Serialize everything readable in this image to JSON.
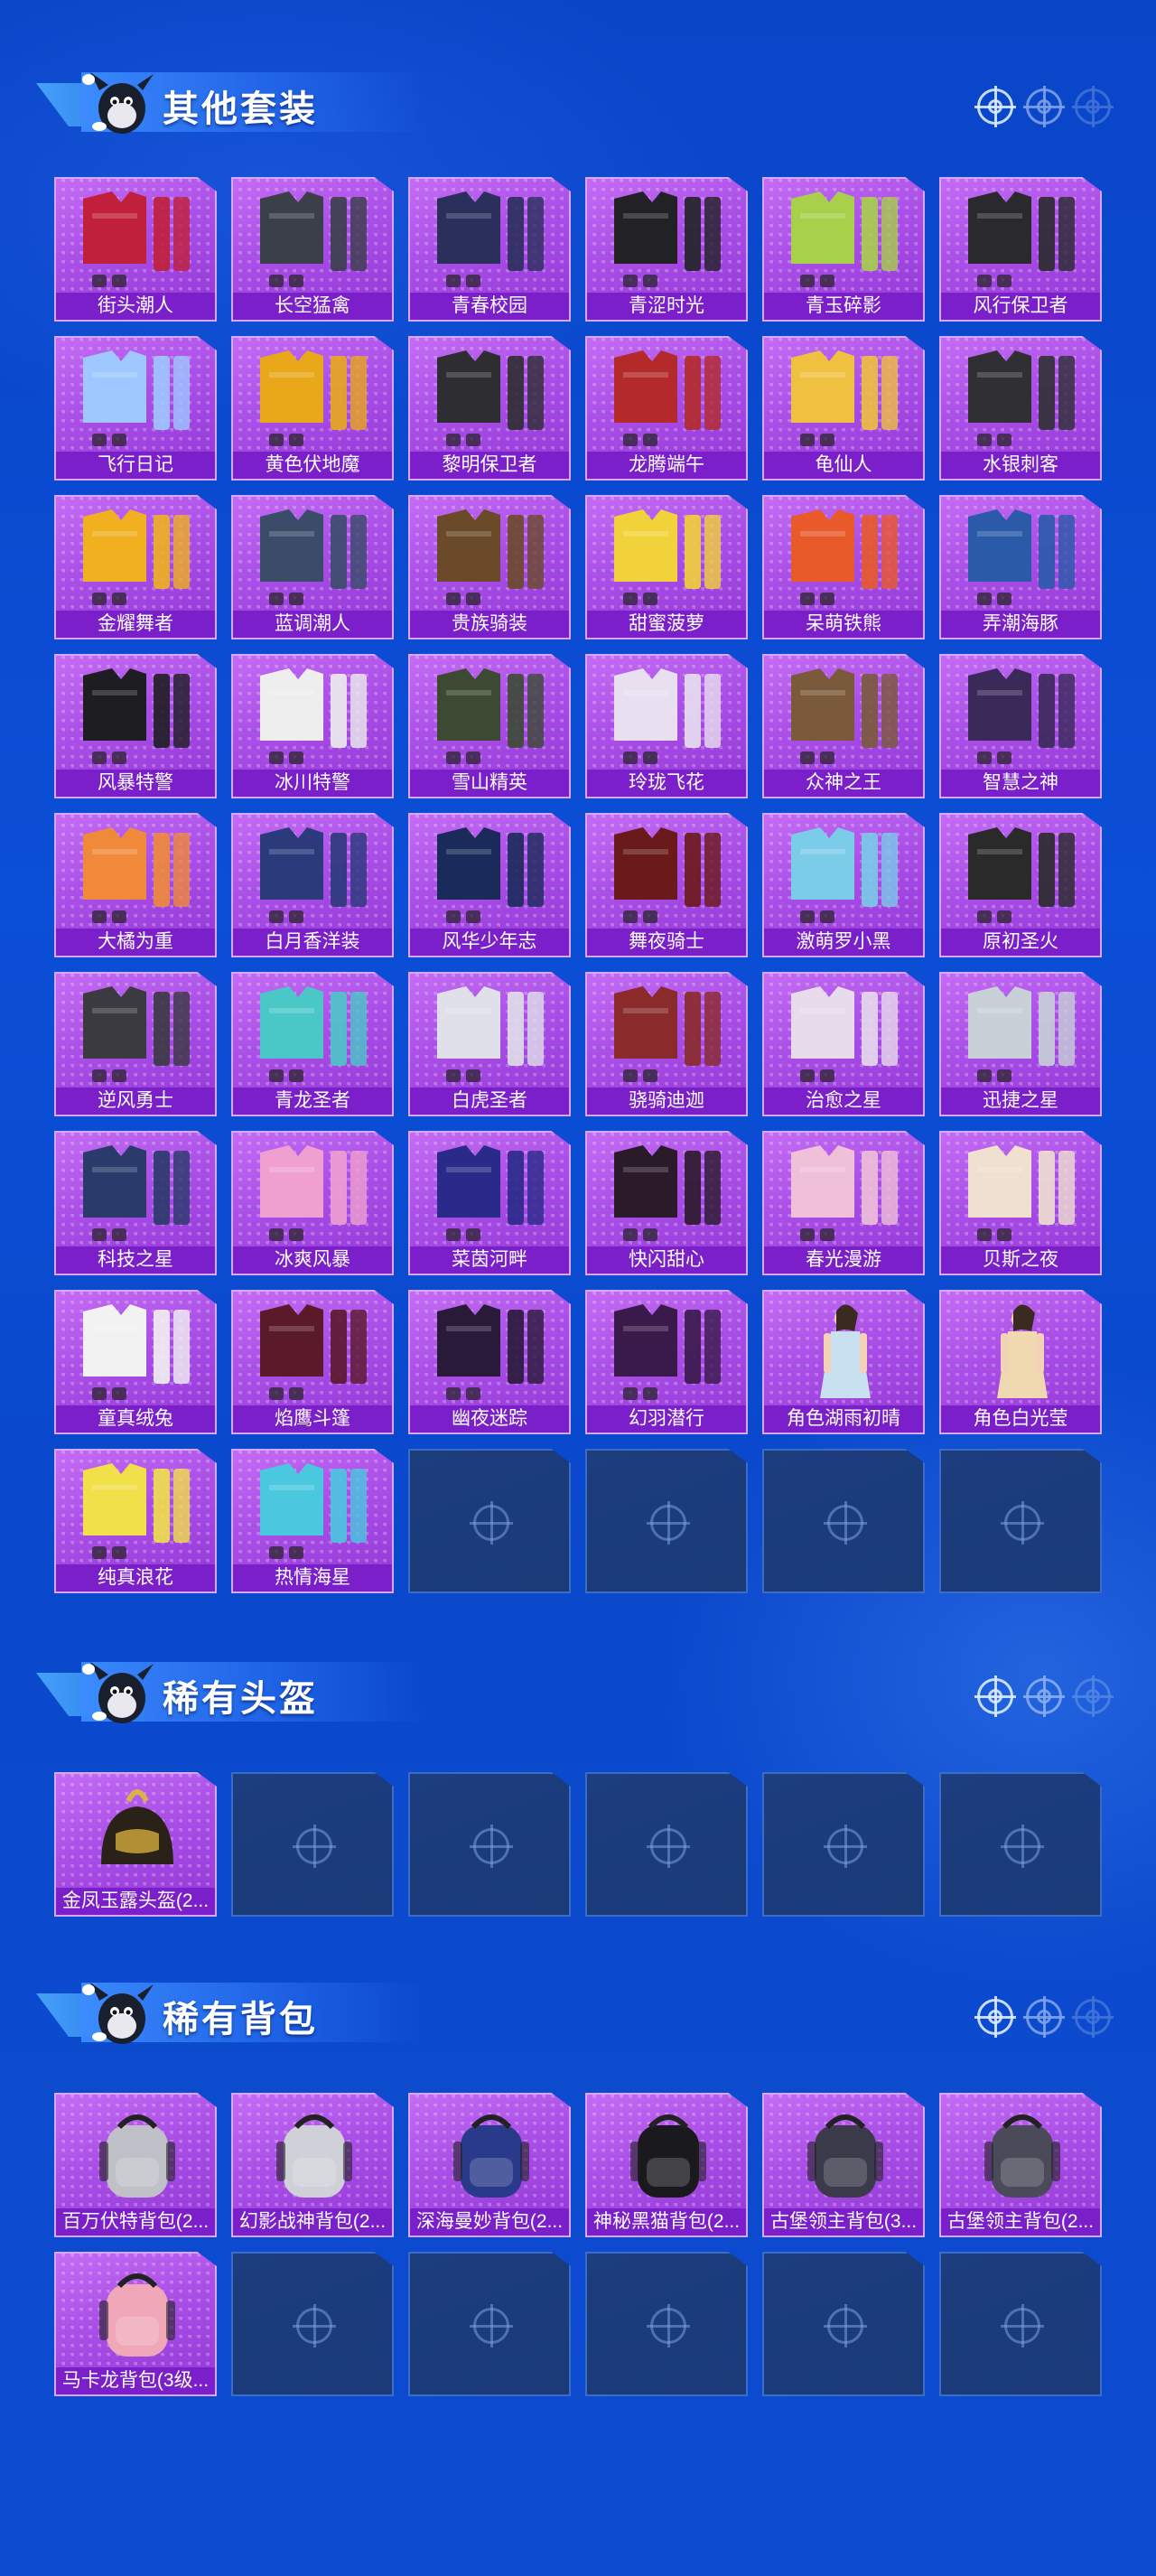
{
  "theme": {
    "accent": "#a94ee6",
    "label_bg": "#7a1fc9",
    "empty_slot": "#1c3d7e",
    "background": "#0b4fd6"
  },
  "sections": [
    {
      "id": "outfits",
      "title": "其他套装",
      "items": [
        {
          "name": "街头潮人",
          "icon": "outfit-icon",
          "color": "#c0203a"
        },
        {
          "name": "长空猛禽",
          "icon": "outfit-icon",
          "color": "#3a3f4a"
        },
        {
          "name": "青春校园",
          "icon": "outfit-icon",
          "color": "#2b2f5c"
        },
        {
          "name": "青涩时光",
          "icon": "outfit-icon",
          "color": "#222226"
        },
        {
          "name": "青玉碎影",
          "icon": "outfit-icon",
          "color": "#a8d04a"
        },
        {
          "name": "风行保卫者",
          "icon": "outfit-icon",
          "color": "#2a2a2e"
        },
        {
          "name": "飞行日记",
          "icon": "outfit-icon",
          "color": "#9ec8ff"
        },
        {
          "name": "黄色伏地魔",
          "icon": "outfit-icon",
          "color": "#e8a81a"
        },
        {
          "name": "黎明保卫者",
          "icon": "outfit-icon",
          "color": "#2e2e32"
        },
        {
          "name": "龙腾端午",
          "icon": "outfit-icon",
          "color": "#b42a2a"
        },
        {
          "name": "龟仙人",
          "icon": "outfit-icon",
          "color": "#f0c040"
        },
        {
          "name": "水银刺客",
          "icon": "outfit-icon",
          "color": "#303034"
        },
        {
          "name": "金耀舞者",
          "icon": "outfit-icon",
          "color": "#f0b020"
        },
        {
          "name": "蓝调潮人",
          "icon": "outfit-icon",
          "color": "#3a4c6a"
        },
        {
          "name": "贵族骑装",
          "icon": "outfit-icon",
          "color": "#6b4a2a"
        },
        {
          "name": "甜蜜菠萝",
          "icon": "outfit-icon",
          "color": "#f2d23a"
        },
        {
          "name": "呆萌铁熊",
          "icon": "outfit-icon",
          "color": "#e85a2a"
        },
        {
          "name": "弄潮海豚",
          "icon": "outfit-icon",
          "color": "#2a5aa8"
        },
        {
          "name": "风暴特警",
          "icon": "outfit-icon",
          "color": "#1e1e22"
        },
        {
          "name": "冰川特警",
          "icon": "outfit-icon",
          "color": "#eeeeee"
        },
        {
          "name": "雪山精英",
          "icon": "outfit-icon",
          "color": "#3c4a34"
        },
        {
          "name": "玲珑飞花",
          "icon": "outfit-icon",
          "color": "#e8e0f0"
        },
        {
          "name": "众神之王",
          "icon": "outfit-icon",
          "color": "#7a5a3a"
        },
        {
          "name": "智慧之神",
          "icon": "outfit-icon",
          "color": "#3a2a5a"
        },
        {
          "name": "大橘为重",
          "icon": "outfit-icon",
          "color": "#f08a3a"
        },
        {
          "name": "白月香洋装",
          "icon": "outfit-icon",
          "color": "#2a3a7a"
        },
        {
          "name": "风华少年志",
          "icon": "outfit-icon",
          "color": "#1a2a5a"
        },
        {
          "name": "舞夜骑士",
          "icon": "outfit-icon",
          "color": "#6a1a1a"
        },
        {
          "name": "激萌罗小黑",
          "icon": "outfit-icon",
          "color": "#7acce8"
        },
        {
          "name": "原初圣火",
          "icon": "outfit-icon",
          "color": "#2a2a2a"
        },
        {
          "name": "逆风勇士",
          "icon": "outfit-icon",
          "color": "#3a3a40"
        },
        {
          "name": "青龙圣者",
          "icon": "outfit-icon",
          "color": "#4ac8c8"
        },
        {
          "name": "白虎圣者",
          "icon": "outfit-icon",
          "color": "#e0e0ea"
        },
        {
          "name": "骁骑迪迦",
          "icon": "outfit-icon",
          "color": "#8a2a2a"
        },
        {
          "name": "治愈之星",
          "icon": "outfit-icon",
          "color": "#e8dcec"
        },
        {
          "name": "迅捷之星",
          "icon": "outfit-icon",
          "color": "#c8d0d8"
        },
        {
          "name": "科技之星",
          "icon": "outfit-icon",
          "color": "#2a3a6a"
        },
        {
          "name": "冰爽风暴",
          "icon": "outfit-icon",
          "color": "#f0a0d0"
        },
        {
          "name": "菜茵河畔",
          "icon": "outfit-icon",
          "color": "#2a2a8a"
        },
        {
          "name": "快闪甜心",
          "icon": "outfit-icon",
          "color": "#2a1a2a"
        },
        {
          "name": "春光漫游",
          "icon": "outfit-icon",
          "color": "#f0c0d8"
        },
        {
          "name": "贝斯之夜",
          "icon": "outfit-icon",
          "color": "#f0e0d0"
        },
        {
          "name": "童真绒兔",
          "icon": "outfit-icon",
          "color": "#f2f2f2"
        },
        {
          "name": "焰鹰斗篷",
          "icon": "outfit-icon",
          "color": "#5a1a2a"
        },
        {
          "name": "幽夜迷踪",
          "icon": "outfit-icon",
          "color": "#2a1a3a"
        },
        {
          "name": "幻羽潜行",
          "icon": "outfit-icon",
          "color": "#3a1a4a"
        },
        {
          "name": "角色湖雨初晴",
          "icon": "character-icon",
          "color": "#c8e0f0"
        },
        {
          "name": "角色白光莹",
          "icon": "character-icon",
          "color": "#f0d8b0"
        },
        {
          "name": "纯真浪花",
          "icon": "outfit-icon",
          "color": "#f2e04a"
        },
        {
          "name": "热情海星",
          "icon": "outfit-icon",
          "color": "#4ac8e0"
        }
      ],
      "empty_slots": 4
    },
    {
      "id": "helmets",
      "title": "稀有头盔",
      "items": [
        {
          "name": "金凤玉露头盔(2...",
          "icon": "helmet-icon",
          "color": "#2a2218"
        }
      ],
      "empty_slots": 5
    },
    {
      "id": "backpacks",
      "title": "稀有背包",
      "items": [
        {
          "name": "百万伏特背包(2...",
          "icon": "backpack-icon",
          "color": "#c0c0c8"
        },
        {
          "name": "幻影战神背包(2...",
          "icon": "backpack-icon",
          "color": "#d0d0d8"
        },
        {
          "name": "深海曼妙背包(2...",
          "icon": "backpack-icon",
          "color": "#2a3a8a"
        },
        {
          "name": "神秘黑猫背包(2...",
          "icon": "backpack-icon",
          "color": "#1a1a1e"
        },
        {
          "name": "古堡领主背包(3...",
          "icon": "backpack-icon",
          "color": "#3a3a4a"
        },
        {
          "name": "古堡领主背包(2...",
          "icon": "backpack-icon",
          "color": "#4a4a5a"
        },
        {
          "name": "马卡龙背包(3级...",
          "icon": "backpack-icon",
          "color": "#f0a8b8"
        }
      ],
      "empty_slots": 5
    }
  ]
}
